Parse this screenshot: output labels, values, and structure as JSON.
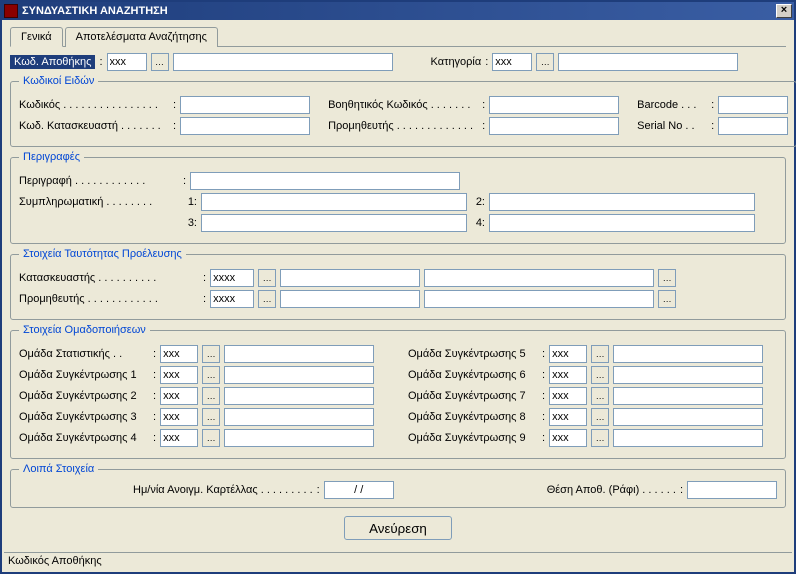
{
  "window": {
    "title": "ΣΥΝΔΥΑΣΤΙΚΗ ΑΝΑΖΗΤΗΣΗ"
  },
  "tabs": {
    "general": "Γενικά",
    "results": "Αποτελέσματα Αναζήτησης"
  },
  "top": {
    "warehouse_code_label": "Κωδ. Αποθήκης",
    "warehouse_code": "xxx",
    "warehouse_desc": "",
    "category_label": "Κατηγορία",
    "category_code": "xxx",
    "category_desc": ""
  },
  "itemCodes": {
    "legend": "Κωδικοί Ειδών",
    "code_label": "Κωδικός . . . . . . . . . . . . . . . .",
    "code": "",
    "aux_label": "Βοηθητικός Κωδικός . . . . . . .",
    "aux": "",
    "barcode_label": "Barcode . . .",
    "barcode": "",
    "mfr_code_label": "Κωδ. Κατασκευαστή . . . . . . .",
    "mfr_code": "",
    "supplier_label": "Προμηθευτής . . . . . . . . . . . . .",
    "supplier": "",
    "serial_label": "Serial No . .",
    "serial": ""
  },
  "descriptions": {
    "legend": "Περιγραφές",
    "desc_label": "Περιγραφή . . . . . . . . . . . .",
    "desc": "",
    "supp_label": "Συμπληρωματική . . . . . . . .",
    "n1": "1:",
    "s1": "",
    "n2": "2:",
    "s2": "",
    "n3": "3:",
    "s3": "",
    "n4": "4:",
    "s4": ""
  },
  "origin": {
    "legend": "Στοιχεία Ταυτότητας Προέλευσης",
    "manufacturer_label": "Κατασκευαστής . . . . . . . . . .",
    "manufacturer_code": "xxxx",
    "supplier_label": "Προμηθευτής . . . . . . . . . . . .",
    "supplier_code": "xxxx"
  },
  "groups": {
    "legend": "Στοιχεία Ομαδοποιήσεων",
    "stat_label": "Ομάδα Στατιστικής . .",
    "c1_label": "Ομάδα Συγκέντρωσης 1",
    "c2_label": "Ομάδα Συγκέντρωσης 2",
    "c3_label": "Ομάδα Συγκέντρωσης 3",
    "c4_label": "Ομάδα Συγκέντρωσης 4",
    "c5_label": "Ομάδα Συγκέντρωσης 5",
    "c6_label": "Ομάδα Συγκέντρωσης 6",
    "c7_label": "Ομάδα Συγκέντρωσης 7",
    "c8_label": "Ομάδα Συγκέντρωσης 8",
    "c9_label": "Ομάδα Συγκέντρωσης 9",
    "code_placeholder": "xxx"
  },
  "other": {
    "legend": "Λοιπά Στοιχεία",
    "opendate_label": "Ημ/νία Ανοιγμ. Καρτέλλας . . . . . . . . .",
    "opendate": "/ /",
    "shelf_label": "Θέση Αποθ. (Ράφι) . . . . . .",
    "shelf": ""
  },
  "actions": {
    "search": "Ανεύρεση"
  },
  "status": {
    "text": "Κωδικός Αποθήκης"
  }
}
